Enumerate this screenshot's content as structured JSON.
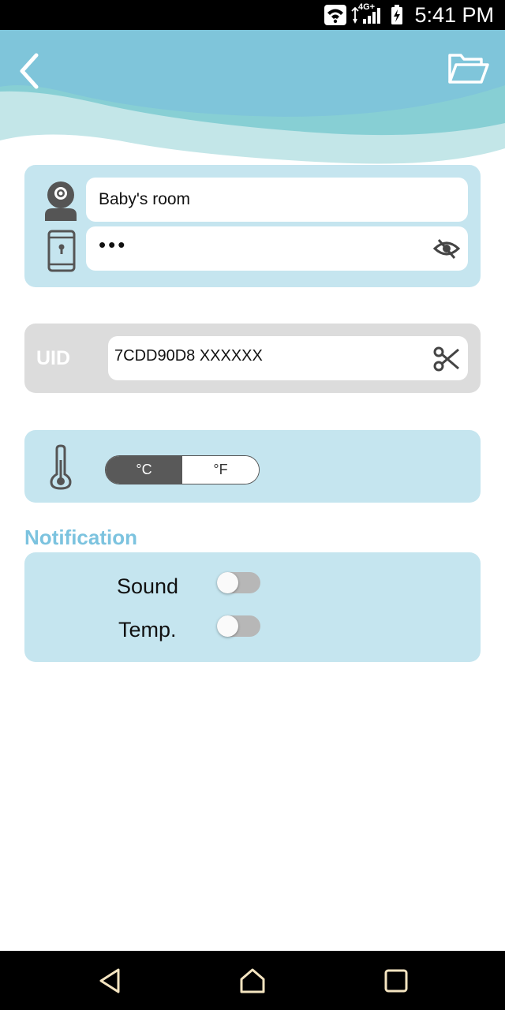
{
  "status_bar": {
    "time": "5:41 PM",
    "network_label": "4G+",
    "icons": [
      "wifi-icon",
      "signal-icon",
      "battery-charging-icon"
    ]
  },
  "header": {
    "back_icon": "chevron-left-icon",
    "folder_icon": "folder-open-icon",
    "wave_colors": [
      "#7ec3da",
      "#87cfd4",
      "#c3e6e8"
    ]
  },
  "camera_card": {
    "name_value": "Baby's room",
    "password_value": "•••",
    "camera_icon": "camera-icon",
    "phone_icon": "phone-lock-icon",
    "eye_icon": "eye-off-icon"
  },
  "uid_card": {
    "label": "UID",
    "value": "7CDD90D8 XXXXXX",
    "scissors_icon": "scissors-icon"
  },
  "temperature_card": {
    "thermometer_icon": "thermometer-icon",
    "unit_celsius": "°C",
    "unit_fahrenheit": "°F",
    "selected_unit": "°C"
  },
  "notification": {
    "title": "Notification",
    "items": [
      {
        "label": "Sound",
        "enabled": false
      },
      {
        "label": "Temp.",
        "enabled": false
      }
    ]
  },
  "nav_bar": {
    "icons": [
      "nav-back-icon",
      "nav-home-icon",
      "nav-recents-icon"
    ]
  },
  "colors": {
    "card_blue": "#c5e5ef",
    "card_gray": "#dcdcdc",
    "accent": "#7cc3df",
    "toggle_active": "#595959"
  }
}
